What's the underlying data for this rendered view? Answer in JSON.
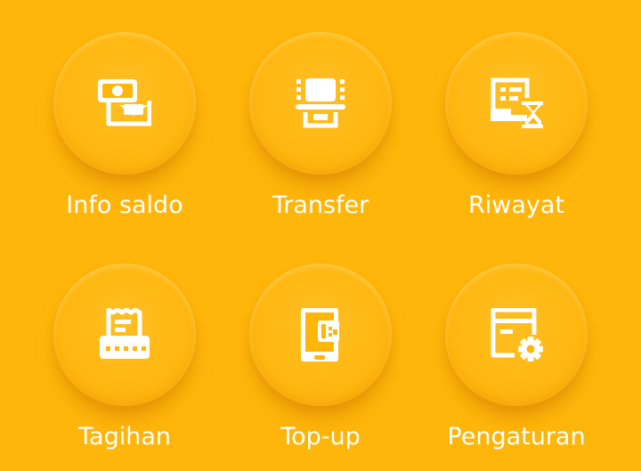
{
  "menu": {
    "items": [
      {
        "label": "Info saldo",
        "icon": "balance-info-icon"
      },
      {
        "label": "Transfer",
        "icon": "atm-transfer-icon"
      },
      {
        "label": "Riwayat",
        "icon": "history-hourglass-icon"
      },
      {
        "label": "Tagihan",
        "icon": "bill-receipt-icon"
      },
      {
        "label": "Top-up",
        "icon": "mobile-topup-icon"
      },
      {
        "label": "Pengaturan",
        "icon": "settings-gear-icon"
      }
    ]
  },
  "colors": {
    "background": "#FFB60A",
    "icon": "#FFFFFF",
    "label": "#FFFFFF"
  }
}
